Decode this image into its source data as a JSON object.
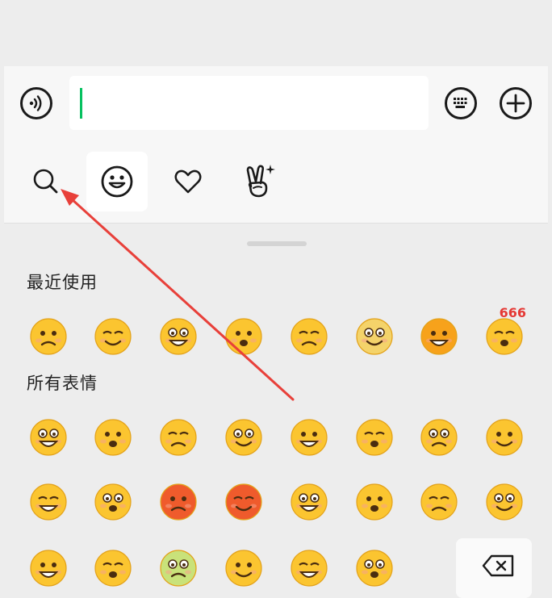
{
  "input_bar": {
    "voice_icon": "voice-icon",
    "keyboard_icon": "keyboard-icon",
    "add_icon": "plus-circle-icon",
    "text_value": ""
  },
  "tabs": [
    {
      "name": "search",
      "icon": "search-icon"
    },
    {
      "name": "emoji",
      "icon": "smiley-icon",
      "active": true
    },
    {
      "name": "favorites",
      "icon": "heart-icon"
    },
    {
      "name": "stickers",
      "icon": "victory-hand-icon"
    }
  ],
  "sections": {
    "recent": "最近使用",
    "all": "所有表情"
  },
  "recent_emojis": [
    {
      "name": "facepalm-emoji",
      "label": ""
    },
    {
      "name": "smirk-emoji",
      "label": ""
    },
    {
      "name": "blush-emoji",
      "label": ""
    },
    {
      "name": "laugh-cry-emoji",
      "label": ""
    },
    {
      "name": "hug-victory-emoji",
      "label": ""
    },
    {
      "name": "doge-emoji",
      "label": ""
    },
    {
      "name": "sun-emoji",
      "label": ""
    },
    {
      "name": "666-emoji",
      "label": "666"
    }
  ],
  "all_emojis": [
    "smile",
    "awkward",
    "heart-eyes",
    "stare",
    "cool",
    "cry",
    "shy",
    "silent",
    "sleep",
    "grimace",
    "angry-red",
    "rage",
    "wink-tongue",
    "grin",
    "surprised",
    "sad",
    "blush-wide",
    "scream",
    "sick",
    "cover-mouth",
    "happy",
    "dazed"
  ],
  "delete_icon": "backspace-icon",
  "colors": {
    "accent": "#07c160",
    "arrow": "#e8403a",
    "emoji_yellow": "#fbc530"
  }
}
